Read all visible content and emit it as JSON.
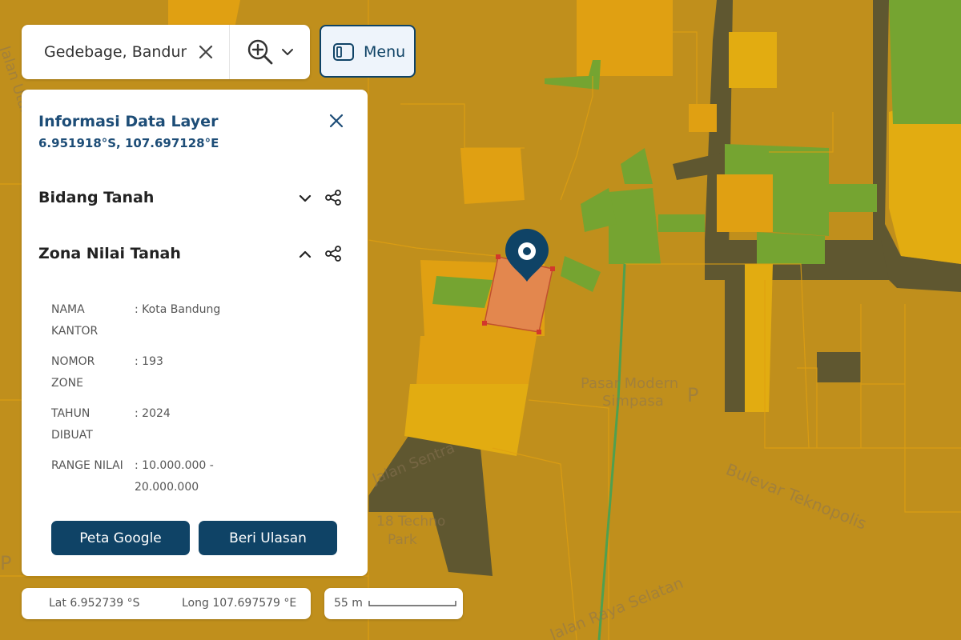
{
  "search": {
    "value": "Gedebage, Bandung"
  },
  "menu": {
    "label": "Menu"
  },
  "panel": {
    "title": "Informasi Data Layer",
    "coords": "6.951918°S, 107.697128°E",
    "sections": [
      {
        "title": "Bidang Tanah",
        "expanded": false
      },
      {
        "title": "Zona Nilai Tanah",
        "expanded": true
      }
    ],
    "attributes": [
      {
        "label": "NAMA KANTOR",
        "value": ": Kota Bandung"
      },
      {
        "label": "NOMOR ZONE",
        "value": ": 193"
      },
      {
        "label": "TAHUN DIBUAT",
        "value": ": 2024"
      },
      {
        "label": "RANGE NILAI",
        "value": ": 10.000.000 - 20.000.000"
      }
    ],
    "buttons": {
      "google": "Peta Google",
      "review": "Beri Ulasan"
    }
  },
  "coordinates": {
    "lat": "Lat 6.952739 °S",
    "lon": "Long 107.697579 °E"
  },
  "scale": {
    "label": "55 m"
  },
  "map_labels": {
    "road_1": "Bulevar Teknopolis",
    "road_2": "Jalan Sentra",
    "road_3": "Jalan Raya Selatan",
    "road_4": "Jalan Utama",
    "poi_1_line1": "Pasar Modern",
    "poi_1_line2": "Simpasa",
    "poi_2_line1": "18 Techno",
    "poi_2_line2": "Park",
    "parking": "P"
  },
  "colors": {
    "map_base": "#c08f1c",
    "parcel_orange": "#e0a012",
    "parcel_green": "#75a431",
    "selected_parcel": "#e3874e",
    "brand": "#0f4366"
  }
}
